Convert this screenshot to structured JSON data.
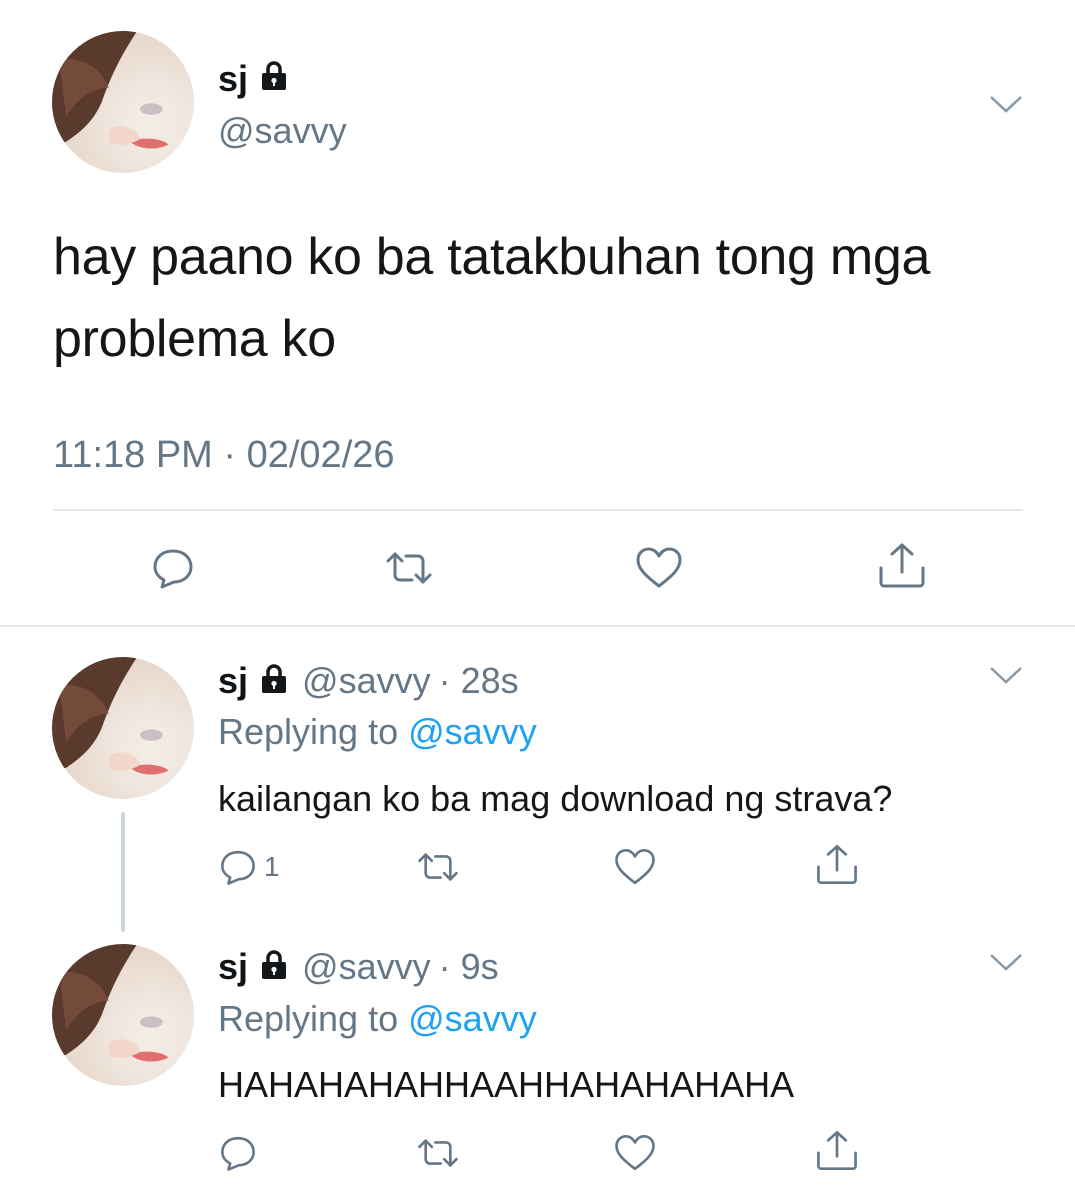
{
  "main_tweet": {
    "name": "sj",
    "handle": "@savvy",
    "text_line1": "hay paano ko ba tatakbuhan tong mga",
    "text_line2": "problema ko",
    "timestamp": "11:18 PM · 02/02/26"
  },
  "replies": [
    {
      "name": "sj",
      "handle": "@savvy",
      "time": "· 28s",
      "replying_prefix": "Replying to",
      "replying_to": "@savvy",
      "text": "kailangan ko ba mag download ng strava?",
      "reply_count": "1"
    },
    {
      "name": "sj",
      "handle": "@savvy",
      "time": "· 9s",
      "replying_prefix": "Replying to",
      "replying_to": "@savvy",
      "text": "HAHAHAHAHHAAHHAHAHAHAHA",
      "reply_count": ""
    }
  ],
  "icons": {
    "reply": "speech-bubble-icon",
    "retweet": "retweet-arrows-icon",
    "like": "heart-icon",
    "share": "share-upload-icon",
    "lock": "lock-icon",
    "more": "chevron-down-icon"
  },
  "colors": {
    "link": "#1da1f2",
    "secondary": "#657786",
    "divider": "#e1e8ed",
    "thread_line": "#ccd6dd"
  }
}
